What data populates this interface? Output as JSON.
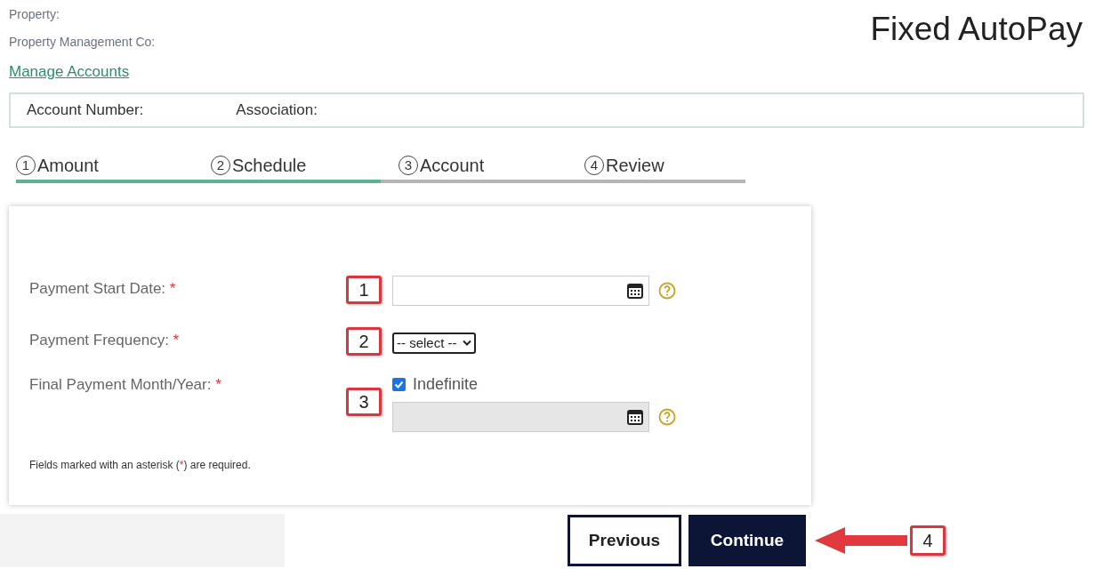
{
  "header": {
    "property_label": "Property:",
    "management_label": "Property Management Co:",
    "manage_link": "Manage Accounts",
    "title": "Fixed AutoPay"
  },
  "account_bar": {
    "account_number_label": "Account Number:",
    "association_label": "Association:"
  },
  "steps": [
    {
      "number": "1",
      "label": "Amount",
      "completed": true
    },
    {
      "number": "2",
      "label": "Schedule",
      "completed": true
    },
    {
      "number": "3",
      "label": "Account",
      "completed": false
    },
    {
      "number": "4",
      "label": "Review",
      "completed": false
    }
  ],
  "form": {
    "fields": [
      {
        "kind": "date",
        "label": "Payment Start Date:",
        "marker": "*",
        "callout": "1",
        "disabled": false
      },
      {
        "kind": "select",
        "label": "Payment Frequency:",
        "marker": "*",
        "callout": "2",
        "value": "-- select --"
      },
      {
        "kind": "indefinite",
        "label": "Final Payment Month/Year:",
        "marker": "*",
        "callout": "3",
        "checkbox_label": "Indefinite",
        "checked": true,
        "disabled": true
      }
    ],
    "footnote": {
      "before": "Fields marked with an asterisk (",
      "mark": "*",
      "after": ") are required."
    }
  },
  "buttons": {
    "previous": "Previous",
    "continue": "Continue",
    "callout": "4"
  }
}
